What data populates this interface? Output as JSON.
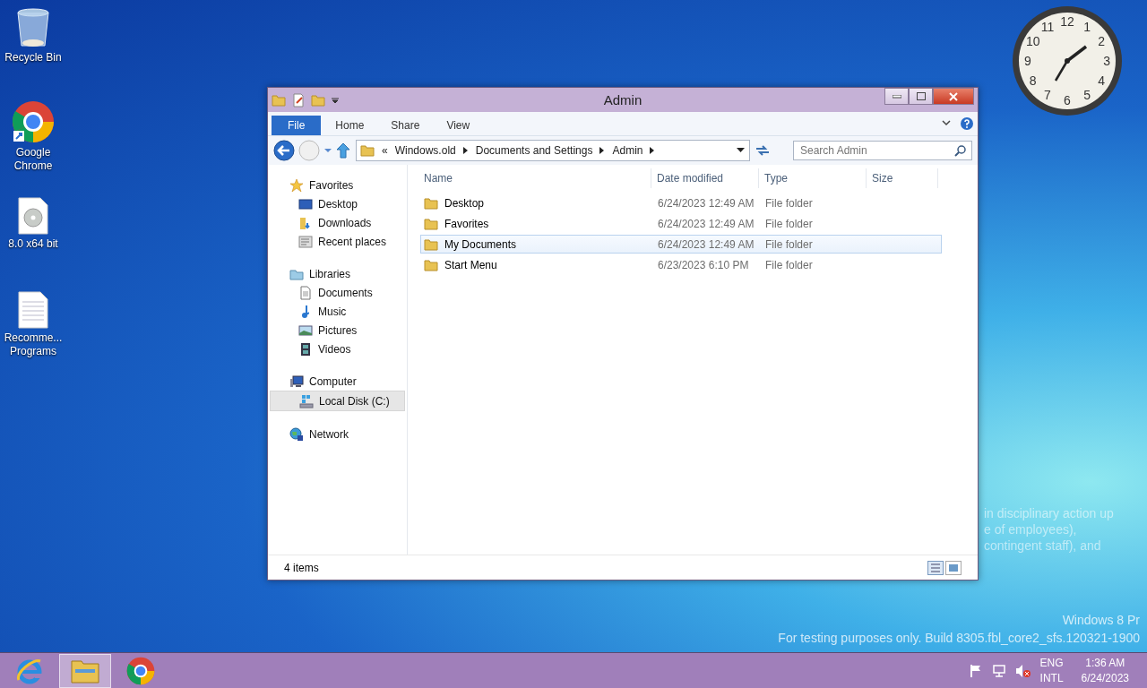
{
  "desktop_icons": [
    {
      "label": "Recycle Bin",
      "kind": "recycle"
    },
    {
      "label": "Google Chrome",
      "kind": "chrome"
    },
    {
      "label": "8.0 x64 bit",
      "kind": "disc"
    },
    {
      "label": "Recomme... Programs",
      "kind": "text"
    }
  ],
  "clock": {
    "numerals": [
      "11",
      "12",
      "1",
      "10",
      "2",
      "9",
      "3",
      "8",
      "4",
      "7",
      "6",
      "5"
    ]
  },
  "window": {
    "title": "Admin",
    "ribbon_tabs": [
      {
        "label": "File",
        "kind": "file"
      },
      {
        "label": "Home",
        "kind": "tab"
      },
      {
        "label": "Share",
        "kind": "tab"
      },
      {
        "label": "View",
        "kind": "tab"
      }
    ],
    "address": {
      "overflow": "«",
      "segments": [
        "Windows.old",
        "Documents and Settings",
        "Admin"
      ]
    },
    "search": {
      "placeholder": "Search Admin"
    },
    "navigation": [
      {
        "label": "Favorites",
        "kind": "favorites",
        "selected": false,
        "children": [
          {
            "label": "Desktop",
            "kind": "desktop",
            "selected": false
          },
          {
            "label": "Downloads",
            "kind": "downloads",
            "selected": false
          },
          {
            "label": "Recent places",
            "kind": "recent",
            "selected": false
          }
        ]
      },
      {
        "label": "Libraries",
        "kind": "libraries",
        "selected": false,
        "children": [
          {
            "label": "Documents",
            "kind": "documents",
            "selected": false
          },
          {
            "label": "Music",
            "kind": "music",
            "selected": false
          },
          {
            "label": "Pictures",
            "kind": "pictures",
            "selected": false
          },
          {
            "label": "Videos",
            "kind": "videos",
            "selected": false
          }
        ]
      },
      {
        "label": "Computer",
        "kind": "computer",
        "selected": false,
        "children": [
          {
            "label": "Local Disk (C:)",
            "kind": "drive",
            "selected": true
          }
        ]
      },
      {
        "label": "Network",
        "kind": "network",
        "selected": false
      }
    ],
    "columns": [
      "Name",
      "Date modified",
      "Type",
      "Size"
    ],
    "rows": [
      {
        "name": "Desktop",
        "date": "6/24/2023 12:49 AM",
        "type": "File folder",
        "selected": false
      },
      {
        "name": "Favorites",
        "date": "6/24/2023 12:49 AM",
        "type": "File folder",
        "selected": false
      },
      {
        "name": "My Documents",
        "date": "6/24/2023 12:49 AM",
        "type": "File folder",
        "selected": true
      },
      {
        "name": "Start Menu",
        "date": "6/23/2023 6:10 PM",
        "type": "File folder",
        "selected": false
      }
    ],
    "status": "4 items"
  },
  "ghost_text": [
    "in disciplinary action up",
    "e of employees),",
    "contingent staff), and"
  ],
  "build_watermark": [
    "Windows 8 Pr",
    "For testing purposes only. Build 8305.fbl_core2_sfs.120321-1900"
  ],
  "taskbar": {
    "apps": [
      {
        "kind": "ie",
        "selected": false
      },
      {
        "kind": "explorer",
        "selected": true
      },
      {
        "kind": "chrome",
        "selected": false
      }
    ],
    "tray": {
      "language": "ENG",
      "layout": "INTL",
      "time": "1:36 AM",
      "date": "6/24/2023"
    }
  }
}
